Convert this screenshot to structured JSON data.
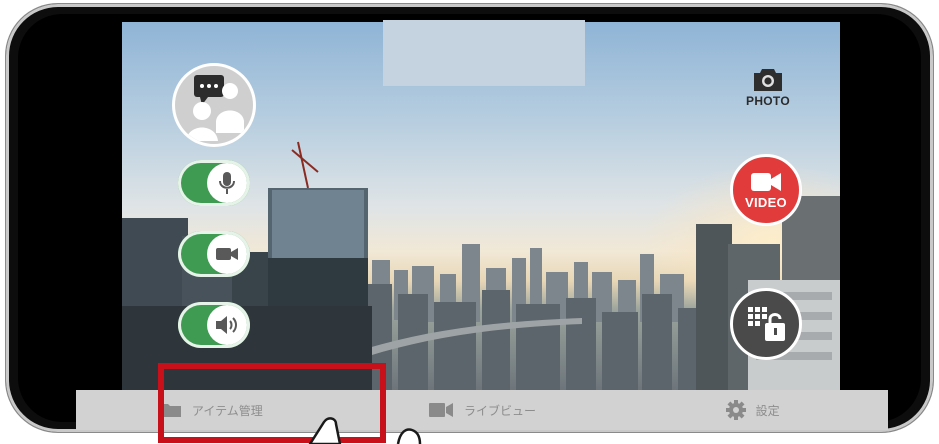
{
  "controls": {
    "photo_label": "PHOTO",
    "video_label": "VIDEO",
    "left_buttons": [
      {
        "icon": "chat-users-icon"
      },
      {
        "icon": "microphone-icon",
        "state": "on"
      },
      {
        "icon": "camera-icon",
        "state": "on"
      },
      {
        "icon": "speaker-icon",
        "state": "on"
      }
    ],
    "right_buttons": [
      {
        "icon": "photo-camera-icon"
      },
      {
        "icon": "video-camera-icon"
      },
      {
        "icon": "keypad-lock-icon"
      }
    ]
  },
  "tabbar": {
    "tabs": [
      {
        "label": "アイテム管理",
        "icon": "folder-icon"
      },
      {
        "label": "ライブビュー",
        "icon": "video-camera-icon"
      },
      {
        "label": "設定",
        "icon": "gear-icon"
      }
    ]
  },
  "colors": {
    "toggle_on": "#3f9a52",
    "video_button": "#e23b3b",
    "highlight": "#c8101a",
    "tabbar": "#d2d2d2"
  }
}
